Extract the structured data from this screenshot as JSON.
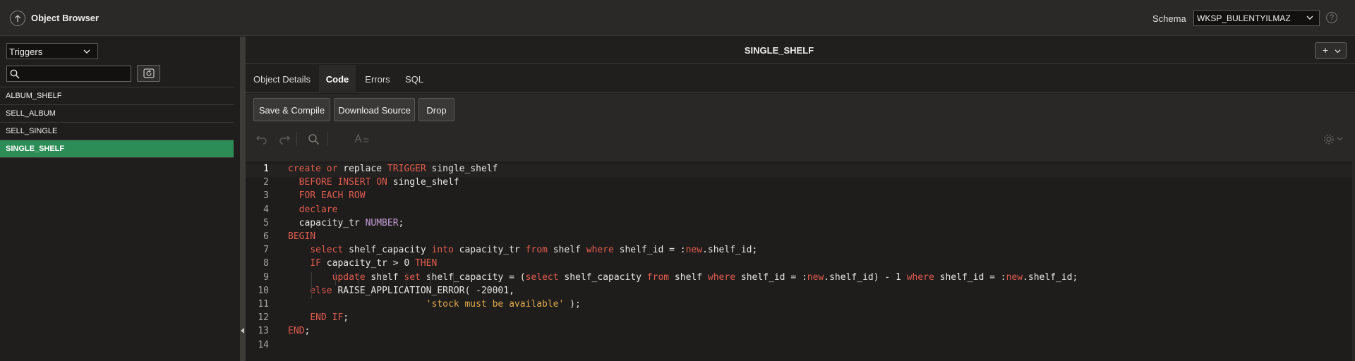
{
  "header": {
    "app_title": "Object Browser",
    "schema_label": "Schema",
    "schema_value": "WKSP_BULENTYILMAZ",
    "help_icon": "?"
  },
  "left": {
    "object_type": "Triggers",
    "search_placeholder": "",
    "items": [
      {
        "label": "ALBUM_SHELF"
      },
      {
        "label": "SELL_ALBUM"
      },
      {
        "label": "SELL_SINGLE"
      },
      {
        "label": "SINGLE_SHELF"
      }
    ],
    "selected_index": 3
  },
  "main": {
    "title": "SINGLE_SHELF",
    "add_menu_label": "+",
    "tabs": [
      {
        "label": "Object Details"
      },
      {
        "label": "Code"
      },
      {
        "label": "Errors"
      },
      {
        "label": "SQL"
      }
    ],
    "active_tab": "Code",
    "buttons": {
      "save_compile": "Save & Compile",
      "download_source": "Download Source",
      "drop": "Drop"
    },
    "code_lines": [
      [
        [
          "kw",
          "create"
        ],
        [
          "id",
          " "
        ],
        [
          "kw",
          "or"
        ],
        [
          "id",
          " replace "
        ],
        [
          "kw",
          "TRIGGER"
        ],
        [
          "id",
          " single_shelf"
        ]
      ],
      [
        [
          "id",
          "  "
        ],
        [
          "kw",
          "BEFORE INSERT ON"
        ],
        [
          "id",
          " single_shelf"
        ]
      ],
      [
        [
          "id",
          "  "
        ],
        [
          "kw",
          "FOR EACH ROW"
        ]
      ],
      [
        [
          "id",
          "  "
        ],
        [
          "kw",
          "declare"
        ]
      ],
      [
        [
          "id",
          "  capacity_tr "
        ],
        [
          "ty",
          "NUMBER"
        ],
        [
          "id",
          ";"
        ]
      ],
      [
        [
          "kw",
          "BEGIN"
        ]
      ],
      [
        [
          "id",
          "    "
        ],
        [
          "kw",
          "select"
        ],
        [
          "id",
          " shelf_capacity "
        ],
        [
          "kw",
          "into"
        ],
        [
          "id",
          " capacity_tr "
        ],
        [
          "kw",
          "from"
        ],
        [
          "id",
          " shelf "
        ],
        [
          "kw",
          "where"
        ],
        [
          "id",
          " shelf_id = :"
        ],
        [
          "kw",
          "new"
        ],
        [
          "id",
          ".shelf_id;"
        ]
      ],
      [
        [
          "id",
          "    "
        ],
        [
          "kw",
          "IF"
        ],
        [
          "id",
          " capacity_tr > 0 "
        ],
        [
          "kw",
          "THEN"
        ]
      ],
      [
        [
          "id",
          "        "
        ],
        [
          "kw",
          "update"
        ],
        [
          "id",
          " shelf "
        ],
        [
          "kw",
          "set"
        ],
        [
          "id",
          " shelf_capacity = ("
        ],
        [
          "kw",
          "select"
        ],
        [
          "id",
          " shelf_capacity "
        ],
        [
          "kw",
          "from"
        ],
        [
          "id",
          " shelf "
        ],
        [
          "kw",
          "where"
        ],
        [
          "id",
          " shelf_id = :"
        ],
        [
          "kw",
          "new"
        ],
        [
          "id",
          ".shelf_id) - 1 "
        ],
        [
          "kw",
          "where"
        ],
        [
          "id",
          " shelf_id = :"
        ],
        [
          "kw",
          "new"
        ],
        [
          "id",
          ".shelf_id;"
        ]
      ],
      [
        [
          "id",
          "    "
        ],
        [
          "kw",
          "else"
        ],
        [
          "id",
          " RAISE_APPLICATION_ERROR( -20001,"
        ]
      ],
      [
        [
          "id",
          "                         "
        ],
        [
          "str",
          "'stock must be available'"
        ],
        [
          "id",
          " );"
        ]
      ],
      [
        [
          "id",
          "    "
        ],
        [
          "kw",
          "END IF"
        ],
        [
          "id",
          ";"
        ]
      ],
      [
        [
          "kw",
          "END"
        ],
        [
          "id",
          ";"
        ]
      ],
      []
    ]
  },
  "colors": {
    "accent": "#2d8d56",
    "keyword": "#e25b4f",
    "string": "#e0a94d",
    "type": "#c39ed6"
  }
}
